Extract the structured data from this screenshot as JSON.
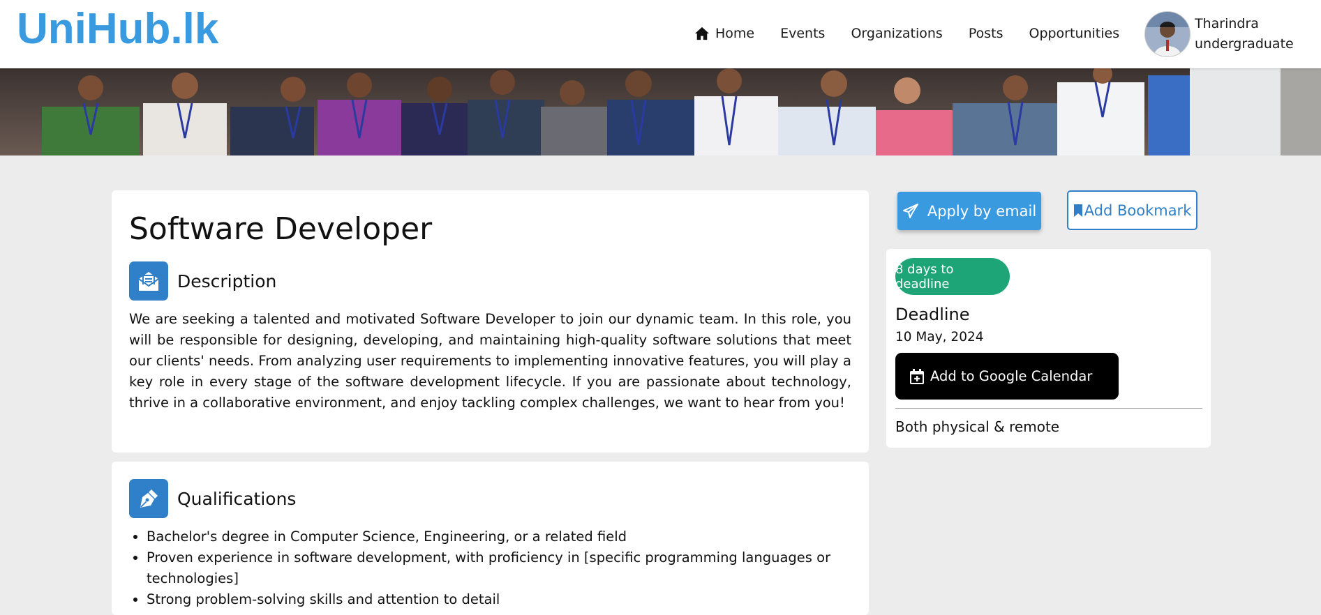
{
  "brand": {
    "logo_text": "UniHub.lk",
    "accent_color": "#3a9ae0"
  },
  "nav": {
    "items": [
      {
        "label": "Home",
        "icon": "home-icon"
      },
      {
        "label": "Events"
      },
      {
        "label": "Organizations"
      },
      {
        "label": "Posts"
      },
      {
        "label": "Opportunities"
      }
    ],
    "user": {
      "name": "Tharindra",
      "role": "undergraduate",
      "avatar": "user-avatar-photo"
    }
  },
  "banner": {
    "image": "group-photo-banner"
  },
  "job": {
    "title": "Software Developer",
    "description": {
      "heading": "Description",
      "icon": "envelope-open-icon",
      "text": "We are seeking a talented and motivated Software Developer to join our dynamic team. In this role, you will be responsible for designing, developing, and maintaining high-quality software solutions that meet our clients' needs. From analyzing user requirements to implementing innovative features, you will play a key role in every stage of the software development lifecycle. If you are passionate about technology, thrive in a collaborative environment, and enjoy tackling complex challenges, we want to hear from you!"
    },
    "qualifications": {
      "heading": "Qualifications",
      "icon": "pen-nib-icon",
      "items": [
        "Bachelor's degree in Computer Science, Engineering, or a related field",
        "Proven experience in software development, with proficiency in [specific programming languages or technologies]",
        "Strong problem-solving skills and attention to detail"
      ]
    }
  },
  "sidebar": {
    "apply_label": "Apply by email",
    "apply_icon": "paper-plane-icon",
    "bookmark_label": "Add Bookmark",
    "bookmark_icon": "bookmark-icon",
    "deadline_badge": "8 days to deadline",
    "deadline_label": "Deadline",
    "deadline_date": "10 May, 2024",
    "calendar_button": "Add to Google Calendar",
    "calendar_icon": "calendar-plus-icon",
    "work_mode": "Both physical & remote",
    "badge_color": "#1da578"
  }
}
